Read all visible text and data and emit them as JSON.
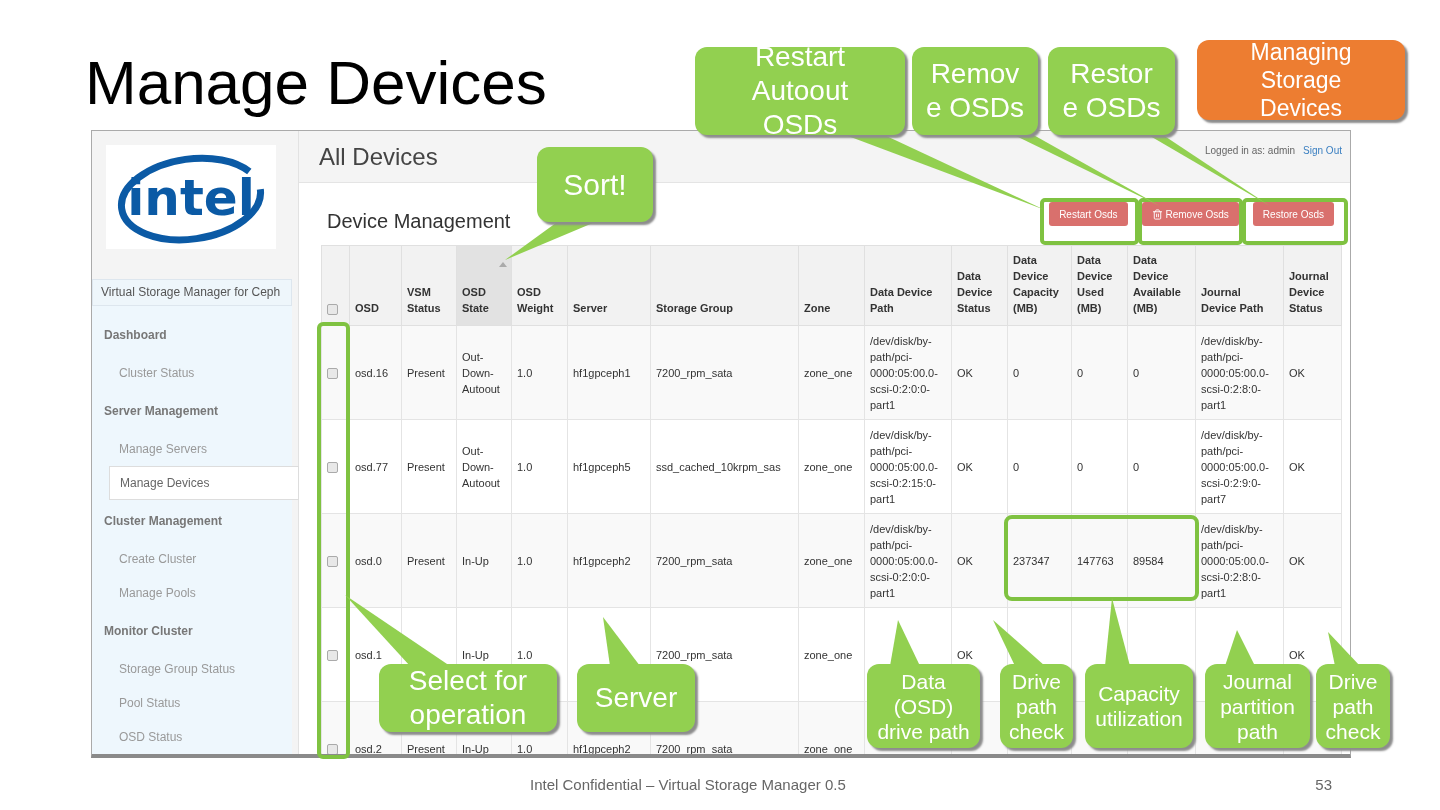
{
  "slide": {
    "title": "Manage Devices",
    "footer": "Intel Confidential – Virtual Storage Manager 0.5",
    "page_number": "53"
  },
  "sidebar": {
    "logo": "intel",
    "tab": "Virtual Storage Manager for Ceph",
    "items": [
      {
        "kind": "heading",
        "label": "Dashboard"
      },
      {
        "kind": "link",
        "label": "Cluster Status",
        "selected": false
      },
      {
        "kind": "heading",
        "label": "Server Management"
      },
      {
        "kind": "link",
        "label": "Manage Servers",
        "selected": false
      },
      {
        "kind": "link",
        "label": "Manage Devices",
        "selected": true
      },
      {
        "kind": "heading",
        "label": "Cluster Management"
      },
      {
        "kind": "link",
        "label": "Create Cluster",
        "selected": false
      },
      {
        "kind": "link",
        "label": "Manage Pools",
        "selected": false
      },
      {
        "kind": "heading",
        "label": "Monitor Cluster"
      },
      {
        "kind": "link",
        "label": "Storage Group Status",
        "selected": false
      },
      {
        "kind": "link",
        "label": "Pool Status",
        "selected": false
      },
      {
        "kind": "link",
        "label": "OSD Status",
        "selected": false
      }
    ]
  },
  "header": {
    "title": "All Devices",
    "user": "Logged in as: admin",
    "sign_out": "Sign Out"
  },
  "section": {
    "title": "Device Management",
    "buttons": [
      {
        "label": "Restart Osds"
      },
      {
        "label": "Remove Osds"
      },
      {
        "label": "Restore Osds"
      }
    ]
  },
  "table": {
    "select_all_checked": false,
    "columns": [
      {
        "label": "OSD",
        "sorted": false
      },
      {
        "label": "VSM Status",
        "sorted": false
      },
      {
        "label": "OSD State",
        "sorted": true
      },
      {
        "label": "OSD Weight",
        "sorted": false
      },
      {
        "label": "Server",
        "sorted": false
      },
      {
        "label": "Storage Group",
        "sorted": false
      },
      {
        "label": "Zone",
        "sorted": false
      },
      {
        "label": "Data Device Path",
        "sorted": false
      },
      {
        "label": "Data Device Status",
        "sorted": false
      },
      {
        "label": "Data Device Capacity (MB)",
        "sorted": false
      },
      {
        "label": "Data Device Used (MB)",
        "sorted": false
      },
      {
        "label": "Data Device Available (MB)",
        "sorted": false
      },
      {
        "label": "Journal Device Path",
        "sorted": false
      },
      {
        "label": "Journal Device Status",
        "sorted": false
      }
    ],
    "rows": [
      {
        "checked": false,
        "cells": [
          "osd.16",
          "Present",
          "Out-Down-Autoout",
          "1.0",
          "hf1gpceph1",
          "7200_rpm_sata",
          "zone_one",
          "/dev/disk/by-path/pci-0000:05:00.0-scsi-0:2:0:0-part1",
          "OK",
          "0",
          "0",
          "0",
          "/dev/disk/by-path/pci-0000:05:00.0-scsi-0:2:8:0-part1",
          "OK"
        ]
      },
      {
        "checked": false,
        "cells": [
          "osd.77",
          "Present",
          "Out-Down-Autoout",
          "1.0",
          "hf1gpceph5",
          "ssd_cached_10krpm_sas",
          "zone_one",
          "/dev/disk/by-path/pci-0000:05:00.0-scsi-0:2:15:0-part1",
          "OK",
          "0",
          "0",
          "0",
          "/dev/disk/by-path/pci-0000:05:00.0-scsi-0:2:9:0-part7",
          "OK"
        ]
      },
      {
        "checked": false,
        "cells": [
          "osd.0",
          "Present",
          "In-Up",
          "1.0",
          "hf1gpceph2",
          "7200_rpm_sata",
          "zone_one",
          "/dev/disk/by-path/pci-0000:05:00.0-scsi-0:2:0:0-part1",
          "OK",
          "237347",
          "147763",
          "89584",
          "/dev/disk/by-path/pci-0000:05:00.0-scsi-0:2:8:0-part1",
          "OK"
        ]
      },
      {
        "checked": false,
        "cells": [
          "osd.1",
          null,
          "In-Up",
          "1.0",
          null,
          "7200_rpm_sata",
          "zone_one",
          null,
          "OK",
          null,
          null,
          null,
          null,
          "OK"
        ]
      },
      {
        "checked": false,
        "cells": [
          "osd.2",
          "Present",
          "In-Up",
          "1.0",
          "hf1gpceph2",
          "7200_rpm_sata",
          "zone_one",
          null,
          null,
          null,
          null,
          null,
          null,
          null
        ]
      }
    ]
  },
  "callouts": [
    {
      "text": "Restart\nAutoout\nOSDs",
      "color": "#92d050"
    },
    {
      "text": "Remov\ne OSDs",
      "color": "#92d050"
    },
    {
      "text": "Restor\ne OSDs",
      "color": "#92d050"
    },
    {
      "text": "Managing\nStorage\nDevices",
      "color": "#ed7d31"
    },
    {
      "text": "Sort!",
      "color": "#92d050"
    },
    {
      "text": "Select for\noperation",
      "color": "#92d050"
    },
    {
      "text": "Server",
      "color": "#92d050"
    },
    {
      "text": "Data\n(OSD)\ndrive path",
      "color": "#92d050"
    },
    {
      "text": "Drive\npath\ncheck",
      "color": "#92d050"
    },
    {
      "text": "Capacity\nutilization",
      "color": "#92d050"
    },
    {
      "text": "Journal\npartition\npath",
      "color": "#92d050"
    },
    {
      "text": "Drive\npath\ncheck",
      "color": "#92d050"
    }
  ]
}
